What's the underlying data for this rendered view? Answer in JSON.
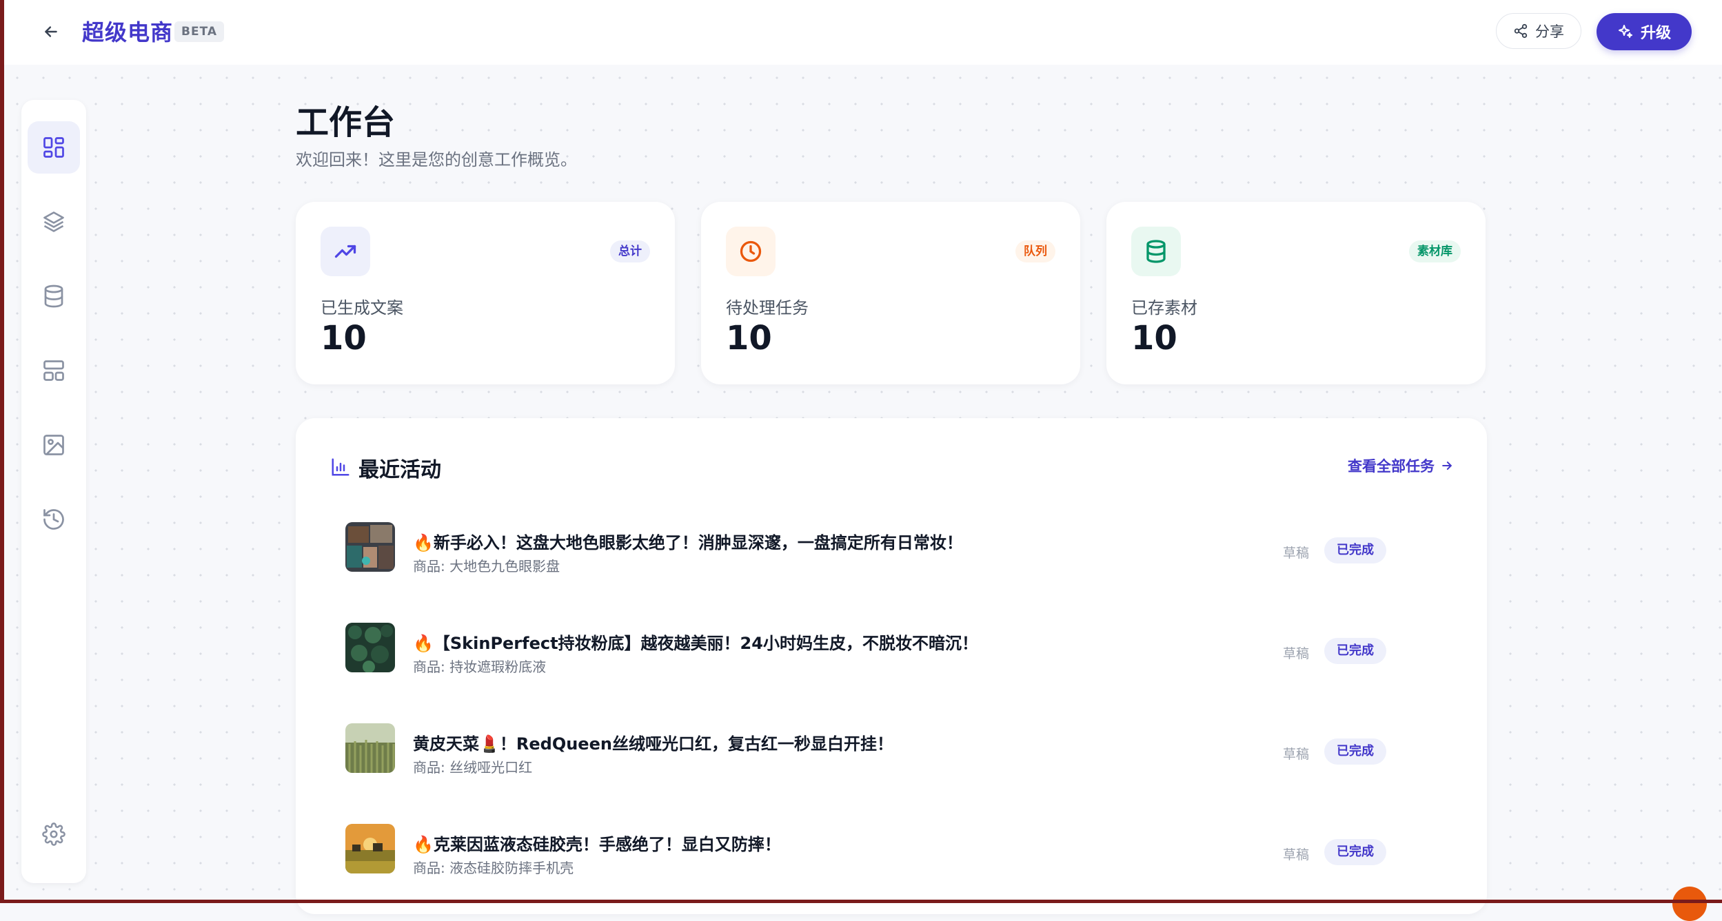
{
  "header": {
    "brand": "超级电商",
    "beta": "BETA",
    "share_label": "分享",
    "upgrade_label": "升级"
  },
  "sidebar": {
    "items": [
      {
        "icon": "dashboard-icon",
        "active": true
      },
      {
        "icon": "layers-icon",
        "active": false
      },
      {
        "icon": "database-icon",
        "active": false
      },
      {
        "icon": "layout-icon",
        "active": false
      },
      {
        "icon": "image-icon",
        "active": false
      },
      {
        "icon": "history-icon",
        "active": false
      }
    ],
    "settings_icon": "gear-icon"
  },
  "page": {
    "title": "工作台",
    "subtitle": "欢迎回来！这里是您的创意工作概览。"
  },
  "stats": [
    {
      "label": "已生成文案",
      "value": "10",
      "tag": "总计",
      "icon": "trend-up-icon",
      "color": "#4f46e5",
      "bg": "#eef0fb",
      "tag_bg": "#eef0fb"
    },
    {
      "label": "待处理任务",
      "value": "10",
      "tag": "队列",
      "icon": "clock-icon",
      "color": "#ea580c",
      "bg": "#fff4ea",
      "tag_bg": "#fff4ea"
    },
    {
      "label": "已存素材",
      "value": "10",
      "tag": "素材库",
      "icon": "database-icon",
      "color": "#059669",
      "bg": "#e9f8f1",
      "tag_bg": "#e9f8f1"
    }
  ],
  "activity": {
    "title": "最近活动",
    "view_all": "查看全部任务",
    "rows": [
      {
        "title": "🔥新手必入！这盘大地色眼影太绝了！消肿显深邃，一盘搞定所有日常妆！",
        "sub": "商品: 大地色九色眼影盘",
        "draft": "草稿",
        "status": "已完成"
      },
      {
        "title": "🔥【SkinPerfect持妆粉底】越夜越美丽！24小时妈生皮，不脱妆不暗沉！",
        "sub": "商品: 持妆遮瑕粉底液",
        "draft": "草稿",
        "status": "已完成"
      },
      {
        "title": "黄皮天菜💄！RedQueen丝绒哑光口红，复古红一秒显白开挂！",
        "sub": "商品: 丝绒哑光口红",
        "draft": "草稿",
        "status": "已完成"
      },
      {
        "title": "🔥克莱因蓝液态硅胶壳！手感绝了！显白又防摔！",
        "sub": "商品: 液态硅胶防摔手机壳",
        "draft": "草稿",
        "status": "已完成"
      }
    ]
  },
  "colors": {
    "accent": "#4338ca",
    "background": "#f7f8fb"
  }
}
